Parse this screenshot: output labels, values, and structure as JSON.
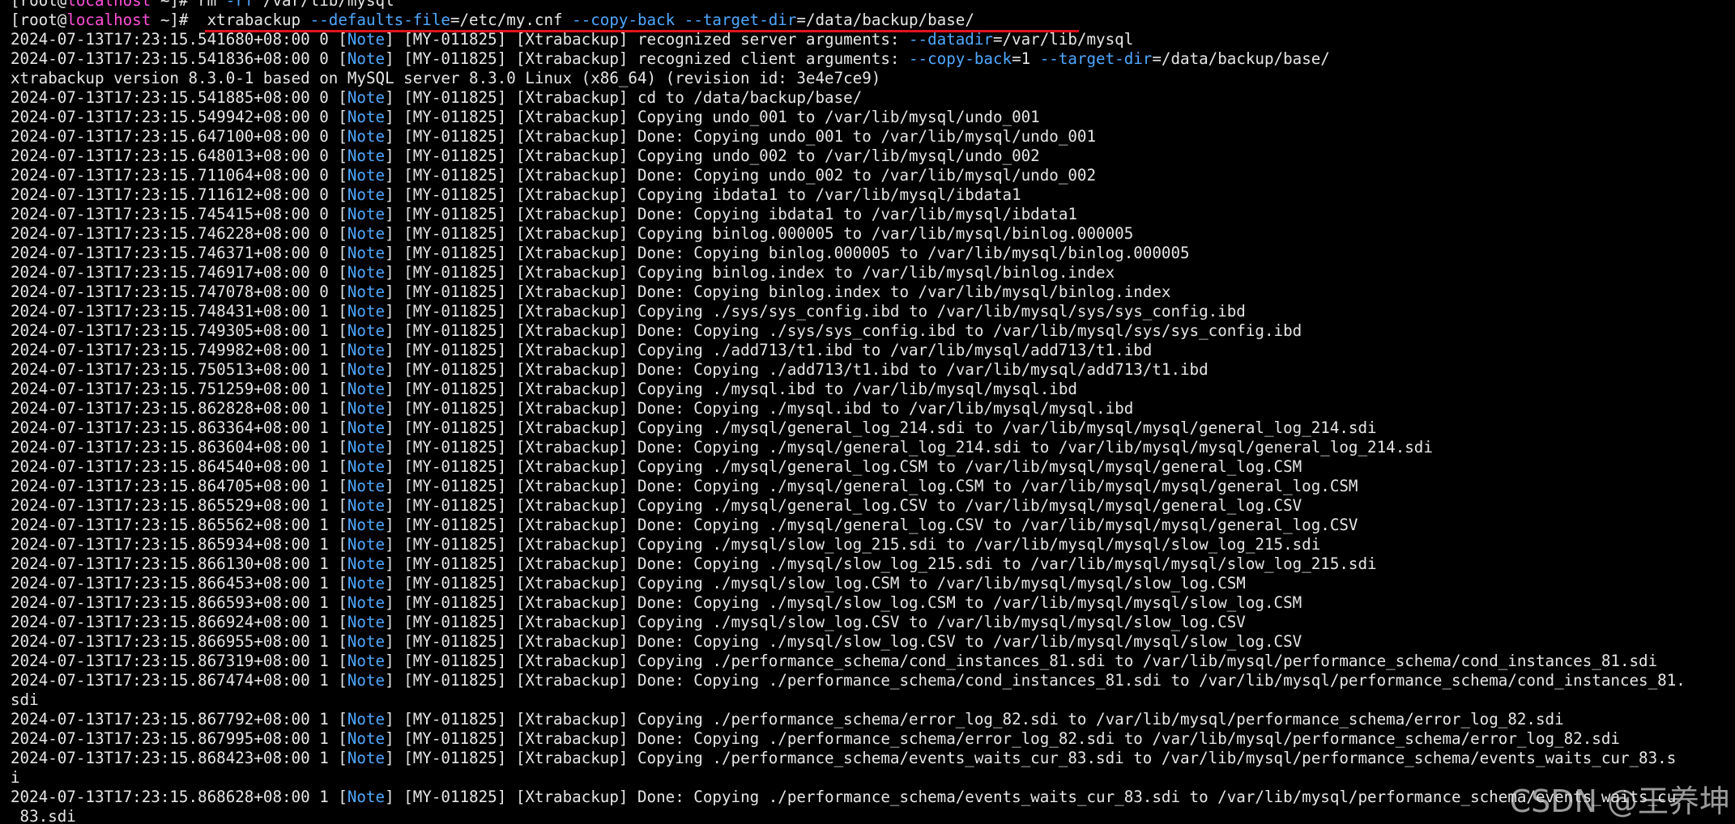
{
  "colors": {
    "background": "#000000",
    "text": "#e6e6e6",
    "hostname": "#ff4fd8",
    "option_keyword": "#4fa8ff",
    "note_tag": "#4fa8ff",
    "annotation_underline": "#e0151b"
  },
  "terminal": {
    "lines": [
      [
        {
          "t": "[root@",
          "c": "text"
        },
        {
          "t": "localhost",
          "c": "host"
        },
        {
          "t": " ~]# rm ",
          "c": "text"
        },
        {
          "t": "-rf",
          "c": "opt"
        },
        {
          "t": " /var/lib/mysql",
          "c": "text"
        }
      ],
      [
        {
          "t": "[root@",
          "c": "text"
        },
        {
          "t": "localhost",
          "c": "host"
        },
        {
          "t": " ~]#  xtrabackup ",
          "c": "text"
        },
        {
          "t": "--defaults-file",
          "c": "opt"
        },
        {
          "t": "=/etc/my.cnf ",
          "c": "text"
        },
        {
          "t": "--copy-back",
          "c": "opt"
        },
        {
          "t": " ",
          "c": "text"
        },
        {
          "t": "--target-dir",
          "c": "opt"
        },
        {
          "t": "=/data/backup/base/",
          "c": "text"
        }
      ],
      [
        {
          "t": "2024-07-13T17:23:15.541680+08:00 0 [",
          "c": "text"
        },
        {
          "t": "Note",
          "c": "note"
        },
        {
          "t": "] [MY-011825] [Xtrabackup] recognized server arguments: ",
          "c": "text"
        },
        {
          "t": "--datadir",
          "c": "opt"
        },
        {
          "t": "=/var/lib/mysql",
          "c": "text"
        }
      ],
      [
        {
          "t": "2024-07-13T17:23:15.541836+08:00 0 [",
          "c": "text"
        },
        {
          "t": "Note",
          "c": "note"
        },
        {
          "t": "] [MY-011825] [Xtrabackup] recognized client arguments: ",
          "c": "text"
        },
        {
          "t": "--copy-back",
          "c": "opt"
        },
        {
          "t": "=1 ",
          "c": "text"
        },
        {
          "t": "--target-dir",
          "c": "opt"
        },
        {
          "t": "=/data/backup/base/",
          "c": "text"
        }
      ],
      [
        {
          "t": "xtrabackup version 8.3.0-1 based on MySQL server 8.3.0 Linux (x86_64) (revision id: 3e4e7ce9)",
          "c": "text"
        }
      ],
      [
        {
          "t": "2024-07-13T17:23:15.541885+08:00 0 [",
          "c": "text"
        },
        {
          "t": "Note",
          "c": "note"
        },
        {
          "t": "] [MY-011825] [Xtrabackup] cd to /data/backup/base/",
          "c": "text"
        }
      ],
      [
        {
          "t": "2024-07-13T17:23:15.549942+08:00 0 [",
          "c": "text"
        },
        {
          "t": "Note",
          "c": "note"
        },
        {
          "t": "] [MY-011825] [Xtrabackup] Copying undo_001 to /var/lib/mysql/undo_001",
          "c": "text"
        }
      ],
      [
        {
          "t": "2024-07-13T17:23:15.647100+08:00 0 [",
          "c": "text"
        },
        {
          "t": "Note",
          "c": "note"
        },
        {
          "t": "] [MY-011825] [Xtrabackup] Done: Copying undo_001 to /var/lib/mysql/undo_001",
          "c": "text"
        }
      ],
      [
        {
          "t": "2024-07-13T17:23:15.648013+08:00 0 [",
          "c": "text"
        },
        {
          "t": "Note",
          "c": "note"
        },
        {
          "t": "] [MY-011825] [Xtrabackup] Copying undo_002 to /var/lib/mysql/undo_002",
          "c": "text"
        }
      ],
      [
        {
          "t": "2024-07-13T17:23:15.711064+08:00 0 [",
          "c": "text"
        },
        {
          "t": "Note",
          "c": "note"
        },
        {
          "t": "] [MY-011825] [Xtrabackup] Done: Copying undo_002 to /var/lib/mysql/undo_002",
          "c": "text"
        }
      ],
      [
        {
          "t": "2024-07-13T17:23:15.711612+08:00 0 [",
          "c": "text"
        },
        {
          "t": "Note",
          "c": "note"
        },
        {
          "t": "] [MY-011825] [Xtrabackup] Copying ibdata1 to /var/lib/mysql/ibdata1",
          "c": "text"
        }
      ],
      [
        {
          "t": "2024-07-13T17:23:15.745415+08:00 0 [",
          "c": "text"
        },
        {
          "t": "Note",
          "c": "note"
        },
        {
          "t": "] [MY-011825] [Xtrabackup] Done: Copying ibdata1 to /var/lib/mysql/ibdata1",
          "c": "text"
        }
      ],
      [
        {
          "t": "2024-07-13T17:23:15.746228+08:00 0 [",
          "c": "text"
        },
        {
          "t": "Note",
          "c": "note"
        },
        {
          "t": "] [MY-011825] [Xtrabackup] Copying binlog.000005 to /var/lib/mysql/binlog.000005",
          "c": "text"
        }
      ],
      [
        {
          "t": "2024-07-13T17:23:15.746371+08:00 0 [",
          "c": "text"
        },
        {
          "t": "Note",
          "c": "note"
        },
        {
          "t": "] [MY-011825] [Xtrabackup] Done: Copying binlog.000005 to /var/lib/mysql/binlog.000005",
          "c": "text"
        }
      ],
      [
        {
          "t": "2024-07-13T17:23:15.746917+08:00 0 [",
          "c": "text"
        },
        {
          "t": "Note",
          "c": "note"
        },
        {
          "t": "] [MY-011825] [Xtrabackup] Copying binlog.index to /var/lib/mysql/binlog.index",
          "c": "text"
        }
      ],
      [
        {
          "t": "2024-07-13T17:23:15.747078+08:00 0 [",
          "c": "text"
        },
        {
          "t": "Note",
          "c": "note"
        },
        {
          "t": "] [MY-011825] [Xtrabackup] Done: Copying binlog.index to /var/lib/mysql/binlog.index",
          "c": "text"
        }
      ],
      [
        {
          "t": "2024-07-13T17:23:15.748431+08:00 1 [",
          "c": "text"
        },
        {
          "t": "Note",
          "c": "note"
        },
        {
          "t": "] [MY-011825] [Xtrabackup] Copying ./sys/sys_config.ibd to /var/lib/mysql/sys/sys_config.ibd",
          "c": "text"
        }
      ],
      [
        {
          "t": "2024-07-13T17:23:15.749305+08:00 1 [",
          "c": "text"
        },
        {
          "t": "Note",
          "c": "note"
        },
        {
          "t": "] [MY-011825] [Xtrabackup] Done: Copying ./sys/sys_config.ibd to /var/lib/mysql/sys/sys_config.ibd",
          "c": "text"
        }
      ],
      [
        {
          "t": "2024-07-13T17:23:15.749982+08:00 1 [",
          "c": "text"
        },
        {
          "t": "Note",
          "c": "note"
        },
        {
          "t": "] [MY-011825] [Xtrabackup] Copying ./add713/t1.ibd to /var/lib/mysql/add713/t1.ibd",
          "c": "text"
        }
      ],
      [
        {
          "t": "2024-07-13T17:23:15.750513+08:00 1 [",
          "c": "text"
        },
        {
          "t": "Note",
          "c": "note"
        },
        {
          "t": "] [MY-011825] [Xtrabackup] Done: Copying ./add713/t1.ibd to /var/lib/mysql/add713/t1.ibd",
          "c": "text"
        }
      ],
      [
        {
          "t": "2024-07-13T17:23:15.751259+08:00 1 [",
          "c": "text"
        },
        {
          "t": "Note",
          "c": "note"
        },
        {
          "t": "] [MY-011825] [Xtrabackup] Copying ./mysql.ibd to /var/lib/mysql/mysql.ibd",
          "c": "text"
        }
      ],
      [
        {
          "t": "2024-07-13T17:23:15.862828+08:00 1 [",
          "c": "text"
        },
        {
          "t": "Note",
          "c": "note"
        },
        {
          "t": "] [MY-011825] [Xtrabackup] Done: Copying ./mysql.ibd to /var/lib/mysql/mysql.ibd",
          "c": "text"
        }
      ],
      [
        {
          "t": "2024-07-13T17:23:15.863364+08:00 1 [",
          "c": "text"
        },
        {
          "t": "Note",
          "c": "note"
        },
        {
          "t": "] [MY-011825] [Xtrabackup] Copying ./mysql/general_log_214.sdi to /var/lib/mysql/mysql/general_log_214.sdi",
          "c": "text"
        }
      ],
      [
        {
          "t": "2024-07-13T17:23:15.863604+08:00 1 [",
          "c": "text"
        },
        {
          "t": "Note",
          "c": "note"
        },
        {
          "t": "] [MY-011825] [Xtrabackup] Done: Copying ./mysql/general_log_214.sdi to /var/lib/mysql/mysql/general_log_214.sdi",
          "c": "text"
        }
      ],
      [
        {
          "t": "2024-07-13T17:23:15.864540+08:00 1 [",
          "c": "text"
        },
        {
          "t": "Note",
          "c": "note"
        },
        {
          "t": "] [MY-011825] [Xtrabackup] Copying ./mysql/general_log.CSM to /var/lib/mysql/mysql/general_log.CSM",
          "c": "text"
        }
      ],
      [
        {
          "t": "2024-07-13T17:23:15.864705+08:00 1 [",
          "c": "text"
        },
        {
          "t": "Note",
          "c": "note"
        },
        {
          "t": "] [MY-011825] [Xtrabackup] Done: Copying ./mysql/general_log.CSM to /var/lib/mysql/mysql/general_log.CSM",
          "c": "text"
        }
      ],
      [
        {
          "t": "2024-07-13T17:23:15.865529+08:00 1 [",
          "c": "text"
        },
        {
          "t": "Note",
          "c": "note"
        },
        {
          "t": "] [MY-011825] [Xtrabackup] Copying ./mysql/general_log.CSV to /var/lib/mysql/mysql/general_log.CSV",
          "c": "text"
        }
      ],
      [
        {
          "t": "2024-07-13T17:23:15.865562+08:00 1 [",
          "c": "text"
        },
        {
          "t": "Note",
          "c": "note"
        },
        {
          "t": "] [MY-011825] [Xtrabackup] Done: Copying ./mysql/general_log.CSV to /var/lib/mysql/mysql/general_log.CSV",
          "c": "text"
        }
      ],
      [
        {
          "t": "2024-07-13T17:23:15.865934+08:00 1 [",
          "c": "text"
        },
        {
          "t": "Note",
          "c": "note"
        },
        {
          "t": "] [MY-011825] [Xtrabackup] Copying ./mysql/slow_log_215.sdi to /var/lib/mysql/mysql/slow_log_215.sdi",
          "c": "text"
        }
      ],
      [
        {
          "t": "2024-07-13T17:23:15.866130+08:00 1 [",
          "c": "text"
        },
        {
          "t": "Note",
          "c": "note"
        },
        {
          "t": "] [MY-011825] [Xtrabackup] Done: Copying ./mysql/slow_log_215.sdi to /var/lib/mysql/mysql/slow_log_215.sdi",
          "c": "text"
        }
      ],
      [
        {
          "t": "2024-07-13T17:23:15.866453+08:00 1 [",
          "c": "text"
        },
        {
          "t": "Note",
          "c": "note"
        },
        {
          "t": "] [MY-011825] [Xtrabackup] Copying ./mysql/slow_log.CSM to /var/lib/mysql/mysql/slow_log.CSM",
          "c": "text"
        }
      ],
      [
        {
          "t": "2024-07-13T17:23:15.866593+08:00 1 [",
          "c": "text"
        },
        {
          "t": "Note",
          "c": "note"
        },
        {
          "t": "] [MY-011825] [Xtrabackup] Done: Copying ./mysql/slow_log.CSM to /var/lib/mysql/mysql/slow_log.CSM",
          "c": "text"
        }
      ],
      [
        {
          "t": "2024-07-13T17:23:15.866924+08:00 1 [",
          "c": "text"
        },
        {
          "t": "Note",
          "c": "note"
        },
        {
          "t": "] [MY-011825] [Xtrabackup] Copying ./mysql/slow_log.CSV to /var/lib/mysql/mysql/slow_log.CSV",
          "c": "text"
        }
      ],
      [
        {
          "t": "2024-07-13T17:23:15.866955+08:00 1 [",
          "c": "text"
        },
        {
          "t": "Note",
          "c": "note"
        },
        {
          "t": "] [MY-011825] [Xtrabackup] Done: Copying ./mysql/slow_log.CSV to /var/lib/mysql/mysql/slow_log.CSV",
          "c": "text"
        }
      ],
      [
        {
          "t": "2024-07-13T17:23:15.867319+08:00 1 [",
          "c": "text"
        },
        {
          "t": "Note",
          "c": "note"
        },
        {
          "t": "] [MY-011825] [Xtrabackup] Copying ./performance_schema/cond_instances_81.sdi to /var/lib/mysql/performance_schema/cond_instances_81.sdi",
          "c": "text"
        }
      ],
      [
        {
          "t": "2024-07-13T17:23:15.867474+08:00 1 [",
          "c": "text"
        },
        {
          "t": "Note",
          "c": "note"
        },
        {
          "t": "] [MY-011825] [Xtrabackup] Done: Copying ./performance_schema/cond_instances_81.sdi to /var/lib/mysql/performance_schema/cond_instances_81.",
          "c": "text"
        }
      ],
      [
        {
          "t": "sdi",
          "c": "text"
        }
      ],
      [
        {
          "t": "2024-07-13T17:23:15.867792+08:00 1 [",
          "c": "text"
        },
        {
          "t": "Note",
          "c": "note"
        },
        {
          "t": "] [MY-011825] [Xtrabackup] Copying ./performance_schema/error_log_82.sdi to /var/lib/mysql/performance_schema/error_log_82.sdi",
          "c": "text"
        }
      ],
      [
        {
          "t": "2024-07-13T17:23:15.867995+08:00 1 [",
          "c": "text"
        },
        {
          "t": "Note",
          "c": "note"
        },
        {
          "t": "] [MY-011825] [Xtrabackup] Done: Copying ./performance_schema/error_log_82.sdi to /var/lib/mysql/performance_schema/error_log_82.sdi",
          "c": "text"
        }
      ],
      [
        {
          "t": "2024-07-13T17:23:15.868423+08:00 1 [",
          "c": "text"
        },
        {
          "t": "Note",
          "c": "note"
        },
        {
          "t": "] [MY-011825] [Xtrabackup] Copying ./performance_schema/events_waits_cur_83.sdi to /var/lib/mysql/performance_schema/events_waits_cur_83.s",
          "c": "text"
        }
      ],
      [
        {
          "t": "i",
          "c": "text"
        }
      ],
      [
        {
          "t": "2024-07-13T17:23:15.868628+08:00 1 [",
          "c": "text"
        },
        {
          "t": "Note",
          "c": "note"
        },
        {
          "t": "] [MY-011825] [Xtrabackup] Done: Copying ./performance_schema/events_waits_cur_83.sdi to /var/lib/mysql/performance_schema/events_waits_cu",
          "c": "text"
        }
      ],
      [
        {
          "t": "_83.sdi",
          "c": "text"
        }
      ]
    ]
  },
  "watermark": {
    "text": "CSDN @王养坤"
  }
}
